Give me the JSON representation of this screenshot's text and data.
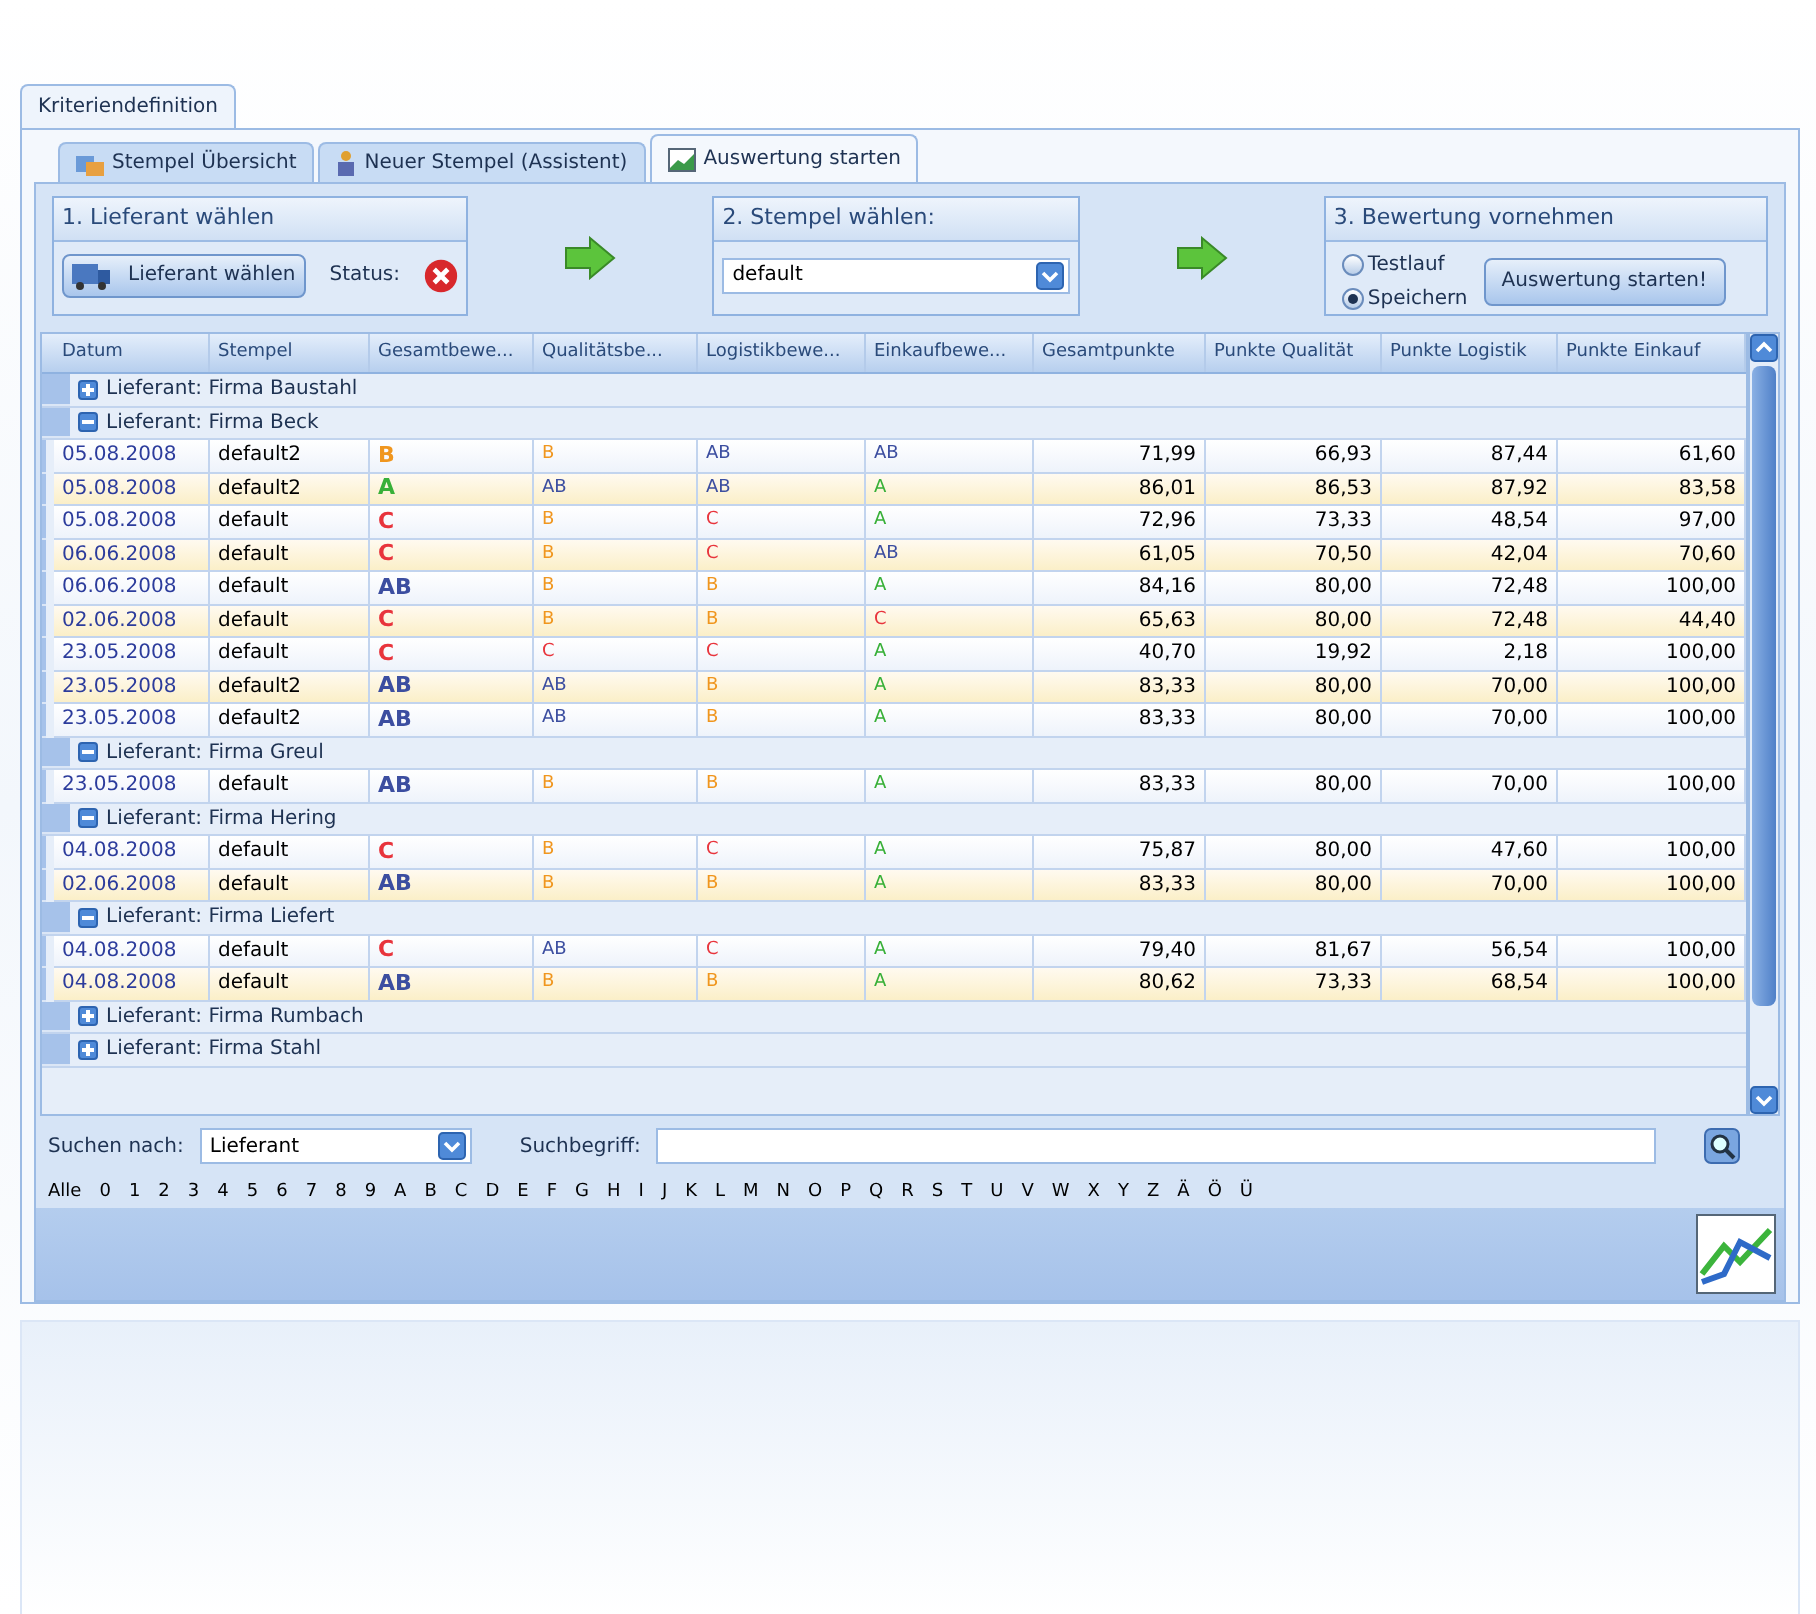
{
  "outer_tab": {
    "label": "Kriteriendefinition"
  },
  "tabs": [
    {
      "label": "Stempel Übersicht",
      "selected": false,
      "kind": "list"
    },
    {
      "label": "Neuer Stempel (Assistent)",
      "selected": false,
      "kind": "wizard"
    },
    {
      "label": "Auswertung starten",
      "selected": true,
      "kind": "chart"
    }
  ],
  "step1": {
    "title": "1. Lieferant wählen",
    "button": "Lieferant wählen",
    "status_label": "Status:",
    "status_ok": false
  },
  "step2": {
    "title": "2. Stempel wählen:",
    "value": "default"
  },
  "step3": {
    "title": "3. Bewertung vornehmen",
    "options": [
      {
        "label": "Testlauf",
        "selected": false
      },
      {
        "label": "Speichern",
        "selected": true
      }
    ],
    "button": "Auswertung starten!"
  },
  "table": {
    "columns": [
      "Datum",
      "Stempel",
      "Gesamtbewe...",
      "Qualitätsbe...",
      "Logistikbewe...",
      "Einkaufbewe...",
      "Gesamtpunkte",
      "Punkte Qualität",
      "Punkte Logistik",
      "Punkte Einkauf"
    ],
    "groups": [
      {
        "label": "Lieferant: Firma Baustahl",
        "expanded": false
      },
      {
        "label": "Lieferant: Firma Beck",
        "expanded": true,
        "rows": [
          {
            "date": "05.08.2008",
            "stamp": "default2",
            "grades": [
              {
                "text": "B",
                "color": "#f0961e"
              },
              {
                "text": "B",
                "color": "#f0961e"
              },
              {
                "text": "AB",
                "color": "#3c4ea0"
              },
              {
                "text": "AB",
                "color": "#3c4ea0"
              }
            ],
            "points": [
              "71,99",
              "66,93",
              "87,44",
              "61,60"
            ]
          },
          {
            "date": "05.08.2008",
            "stamp": "default2",
            "grades": [
              {
                "text": "A",
                "color": "#38b038"
              },
              {
                "text": "AB",
                "color": "#3c4ea0"
              },
              {
                "text": "AB",
                "color": "#3c4ea0"
              },
              {
                "text": "A",
                "color": "#38b038"
              }
            ],
            "points": [
              "86,01",
              "86,53",
              "87,92",
              "83,58"
            ]
          },
          {
            "date": "05.08.2008",
            "stamp": "default",
            "grades": [
              {
                "text": "C",
                "color": "#e8343c"
              },
              {
                "text": "B",
                "color": "#f0961e"
              },
              {
                "text": "C",
                "color": "#e8343c"
              },
              {
                "text": "A",
                "color": "#38b038"
              }
            ],
            "points": [
              "72,96",
              "73,33",
              "48,54",
              "97,00"
            ]
          },
          {
            "date": "06.06.2008",
            "stamp": "default",
            "grades": [
              {
                "text": "C",
                "color": "#e8343c"
              },
              {
                "text": "B",
                "color": "#f0961e"
              },
              {
                "text": "C",
                "color": "#e8343c"
              },
              {
                "text": "AB",
                "color": "#3c4ea0"
              }
            ],
            "points": [
              "61,05",
              "70,50",
              "42,04",
              "70,60"
            ]
          },
          {
            "date": "06.06.2008",
            "stamp": "default",
            "grades": [
              {
                "text": "AB",
                "color": "#3c4ea0"
              },
              {
                "text": "B",
                "color": "#f0961e"
              },
              {
                "text": "B",
                "color": "#f0961e"
              },
              {
                "text": "A",
                "color": "#38b038"
              }
            ],
            "points": [
              "84,16",
              "80,00",
              "72,48",
              "100,00"
            ]
          },
          {
            "date": "02.06.2008",
            "stamp": "default",
            "grades": [
              {
                "text": "C",
                "color": "#e8343c"
              },
              {
                "text": "B",
                "color": "#f0961e"
              },
              {
                "text": "B",
                "color": "#f0961e"
              },
              {
                "text": "C",
                "color": "#e8343c"
              }
            ],
            "points": [
              "65,63",
              "80,00",
              "72,48",
              "44,40"
            ]
          },
          {
            "date": "23.05.2008",
            "stamp": "default",
            "grades": [
              {
                "text": "C",
                "color": "#e8343c"
              },
              {
                "text": "C",
                "color": "#e8343c"
              },
              {
                "text": "C",
                "color": "#e8343c"
              },
              {
                "text": "A",
                "color": "#38b038"
              }
            ],
            "points": [
              "40,70",
              "19,92",
              "2,18",
              "100,00"
            ]
          },
          {
            "date": "23.05.2008",
            "stamp": "default2",
            "grades": [
              {
                "text": "AB",
                "color": "#3c4ea0"
              },
              {
                "text": "AB",
                "color": "#3c4ea0"
              },
              {
                "text": "B",
                "color": "#f0961e"
              },
              {
                "text": "A",
                "color": "#38b038"
              }
            ],
            "points": [
              "83,33",
              "80,00",
              "70,00",
              "100,00"
            ]
          },
          {
            "date": "23.05.2008",
            "stamp": "default2",
            "grades": [
              {
                "text": "AB",
                "color": "#3c4ea0"
              },
              {
                "text": "AB",
                "color": "#3c4ea0"
              },
              {
                "text": "B",
                "color": "#f0961e"
              },
              {
                "text": "A",
                "color": "#38b038"
              }
            ],
            "points": [
              "83,33",
              "80,00",
              "70,00",
              "100,00"
            ]
          }
        ]
      },
      {
        "label": "Lieferant: Firma Greul",
        "expanded": true,
        "rows": [
          {
            "date": "23.05.2008",
            "stamp": "default",
            "grades": [
              {
                "text": "AB",
                "color": "#3c4ea0"
              },
              {
                "text": "B",
                "color": "#f0961e"
              },
              {
                "text": "B",
                "color": "#f0961e"
              },
              {
                "text": "A",
                "color": "#38b038"
              }
            ],
            "points": [
              "83,33",
              "80,00",
              "70,00",
              "100,00"
            ]
          }
        ]
      },
      {
        "label": "Lieferant: Firma Hering",
        "expanded": true,
        "rows": [
          {
            "date": "04.08.2008",
            "stamp": "default",
            "grades": [
              {
                "text": "C",
                "color": "#e8343c"
              },
              {
                "text": "B",
                "color": "#f0961e"
              },
              {
                "text": "C",
                "color": "#e8343c"
              },
              {
                "text": "A",
                "color": "#38b038"
              }
            ],
            "points": [
              "75,87",
              "80,00",
              "47,60",
              "100,00"
            ]
          },
          {
            "date": "02.06.2008",
            "stamp": "default",
            "grades": [
              {
                "text": "AB",
                "color": "#3c4ea0"
              },
              {
                "text": "B",
                "color": "#f0961e"
              },
              {
                "text": "B",
                "color": "#f0961e"
              },
              {
                "text": "A",
                "color": "#38b038"
              }
            ],
            "points": [
              "83,33",
              "80,00",
              "70,00",
              "100,00"
            ]
          }
        ]
      },
      {
        "label": "Lieferant: Firma Liefert",
        "expanded": true,
        "rows": [
          {
            "date": "04.08.2008",
            "stamp": "default",
            "grades": [
              {
                "text": "C",
                "color": "#e8343c"
              },
              {
                "text": "AB",
                "color": "#3c4ea0"
              },
              {
                "text": "C",
                "color": "#e8343c"
              },
              {
                "text": "A",
                "color": "#38b038"
              }
            ],
            "points": [
              "79,40",
              "81,67",
              "56,54",
              "100,00"
            ]
          },
          {
            "date": "04.08.2008",
            "stamp": "default",
            "grades": [
              {
                "text": "AB",
                "color": "#3c4ea0"
              },
              {
                "text": "B",
                "color": "#f0961e"
              },
              {
                "text": "B",
                "color": "#f0961e"
              },
              {
                "text": "A",
                "color": "#38b038"
              }
            ],
            "points": [
              "80,62",
              "73,33",
              "68,54",
              "100,00"
            ]
          }
        ]
      },
      {
        "label": "Lieferant: Firma Rumbach",
        "expanded": false
      },
      {
        "label": "Lieferant: Firma Stahl",
        "expanded": false
      }
    ]
  },
  "search": {
    "label": "Suchen nach:",
    "field": "Lieferant",
    "term_label": "Suchbegriff:"
  },
  "index": [
    "Alle",
    "0",
    "1",
    "2",
    "3",
    "4",
    "5",
    "6",
    "7",
    "8",
    "9",
    "A",
    "B",
    "C",
    "D",
    "E",
    "F",
    "G",
    "H",
    "I",
    "J",
    "K",
    "L",
    "M",
    "N",
    "O",
    "P",
    "Q",
    "R",
    "S",
    "T",
    "U",
    "V",
    "W",
    "X",
    "Y",
    "Z",
    "Ä",
    "Ö",
    "Ü"
  ]
}
